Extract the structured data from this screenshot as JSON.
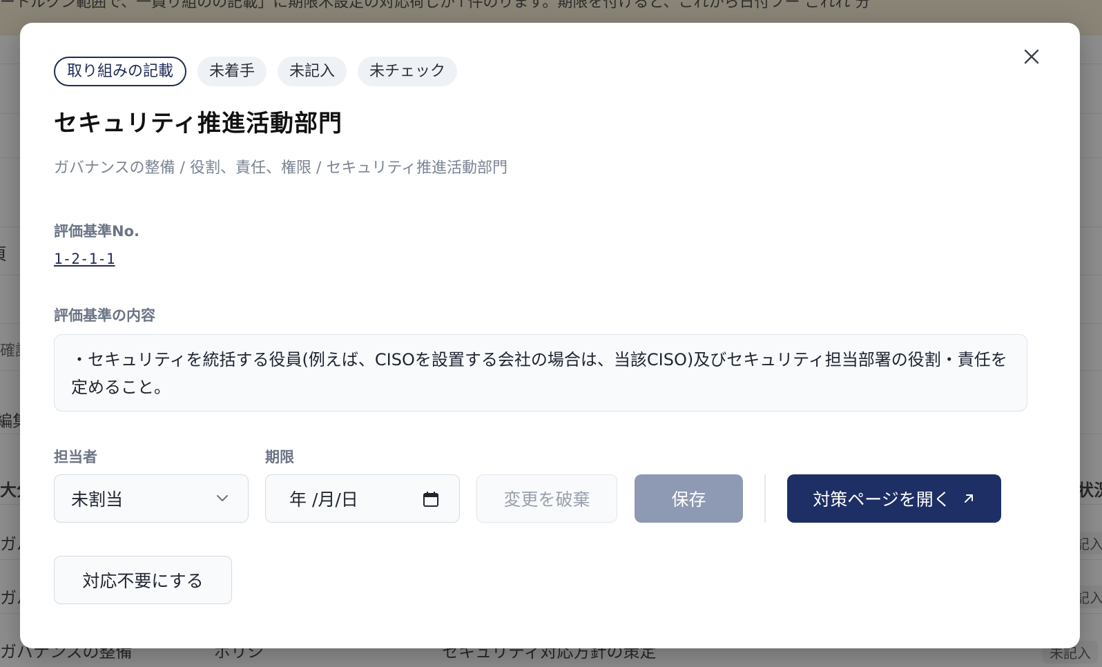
{
  "background": {
    "banner_text": "ートルクン範囲で、一員り組のの記載」に期限木設定の対応荷じが↑件のります。期限を付けると、これから日付フー ごれれ 分",
    "fragments": [
      "頁",
      "確認",
      "編集",
      "大分",
      "状況",
      "ガバ",
      "ガバ",
      "ガバナンスの整備",
      "ポリシ",
      "セキュリティ対応方針の策定",
      "未記入",
      "未記入",
      "未記入"
    ]
  },
  "modal": {
    "tags": [
      "取り組みの記載",
      "未着手",
      "未記入",
      "未チェック"
    ],
    "title": "セキュリティ推進活動部門",
    "breadcrumb": "ガバナンスの整備 / 役割、責任、権限 / セキュリティ推進活動部門",
    "std_no_label": "評価基準No.",
    "std_no": "1-2-1-1",
    "content_label": "評価基準の内容",
    "content": "・セキュリティを統括する役員(例えば、CISOを設置する会社の場合は、当該CISO)及びセキュリティ担当部署の役割・責任を定めること。",
    "assignee_label": "担当者",
    "assignee_value": "未割当",
    "deadline_label": "期限",
    "deadline_value": "年 /月/日",
    "discard_label": "変更を破棄",
    "save_label": "保存",
    "open_label": "対策ページを開く",
    "not_needed_label": "対応不要にする"
  },
  "icons": [
    "close-icon",
    "chevron-down-icon",
    "calendar-icon",
    "external-link-icon"
  ],
  "colors": {
    "primary": "#1e2f66",
    "save_disabled": "#8e99b3"
  }
}
